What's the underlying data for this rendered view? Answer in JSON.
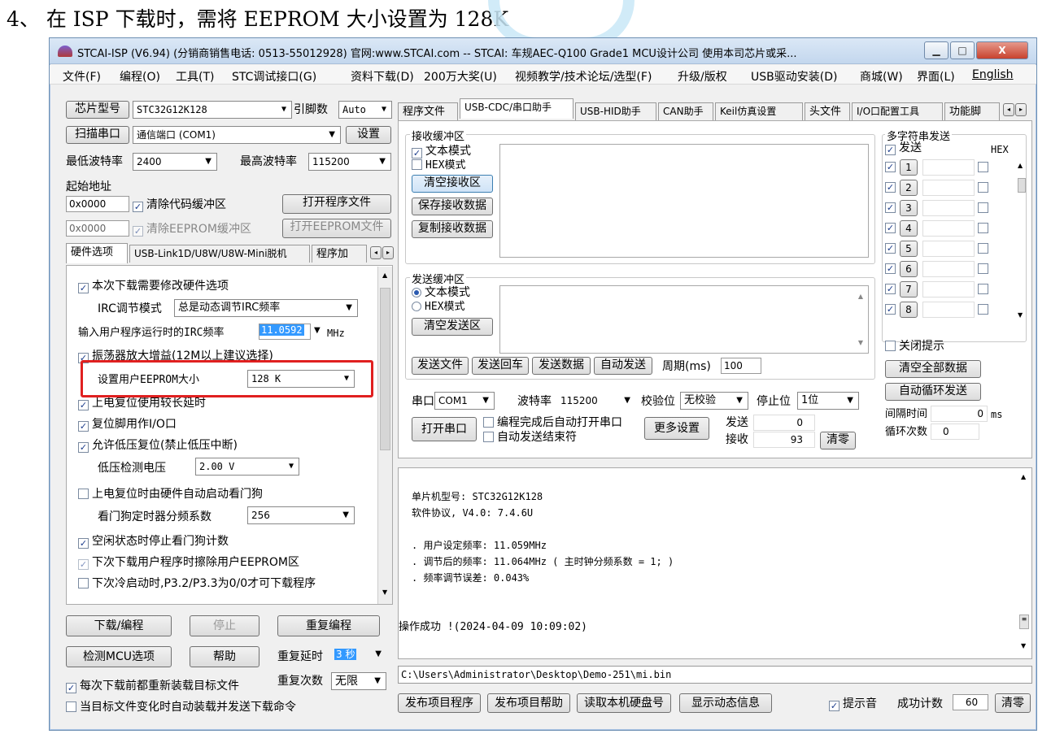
{
  "caption": "4、 在 ISP 下载时，需将 EEPROM 大小设置为 128K",
  "window": {
    "title": "STCAI-ISP (V6.94) (分销商销售电话: 0513-55012928) 官网:www.STCAI.com  -- STCAI: 车规AEC-Q100 Grade1 MCU设计公司 使用本司芯片或采...",
    "minimize": "▁",
    "maximize": "□",
    "close": "X"
  },
  "menu": [
    "文件(F)",
    "编程(O)",
    "工具(T)",
    "STC调试接口(G)",
    "资料下载(D)",
    "200万大奖(U)",
    "视频教学/技术论坛/选型(F)",
    "升级/版权",
    "USB驱动安装(D)",
    "商城(W)",
    "界面(L)",
    "English"
  ],
  "left": {
    "chip_btn": "芯片型号",
    "chip_value": "STC32G12K128",
    "pins_label": "引脚数",
    "pins_value": "Auto",
    "scan_btn": "扫描串口",
    "port_value": "通信端口 (COM1)",
    "settings_btn": "设置",
    "min_baud_label": "最低波特率",
    "min_baud": "2400",
    "max_baud_label": "最高波特率",
    "max_baud": "115200",
    "start_addr_label": "起始地址",
    "code_addr": "0x0000",
    "clear_code": "清除代码缓冲区",
    "open_prog": "打开程序文件",
    "eep_addr": "0x0000",
    "clear_eep": "清除EEPROM缓冲区",
    "open_eep": "打开EEPROM文件",
    "tabs": [
      "硬件选项",
      "USB-Link1D/U8W/U8W-Mini脱机",
      "程序加"
    ],
    "opt_hw": "本次下载需要修改硬件选项",
    "irc_mode_label": "IRC调节模式",
    "irc_mode": "总是动态调节IRC频率",
    "irc_freq_label": "输入用户程序运行时的IRC频率",
    "irc_freq": "11.0592",
    "irc_unit": "MHz",
    "opt_osc": "振荡器放大增益(12M以上建议选择)",
    "eeprom_label": "设置用户EEPROM大小",
    "eeprom_value": "128  K",
    "opt_delay": "上电复位使用较长延时",
    "opt_reset_io": "复位脚用作I/O口",
    "opt_lvr": "允许低压复位(禁止低压中断)",
    "lvd_label": "低压检测电压",
    "lvd_value": "2.00 V",
    "opt_wdt": "上电复位时由硬件自动启动看门狗",
    "wdt_div_label": "看门狗定时器分频系数",
    "wdt_div": "256",
    "opt_idle_wdt": "空闲状态时停止看门狗计数",
    "opt_erase_eep": "下次下载用户程序时擦除用户EEPROM区",
    "opt_cold": "下次冷启动时,P3.2/P3.3为0/0才可下载程序",
    "download_btn": "下载/编程",
    "stop_btn": "停止",
    "reprog_btn": "重复编程",
    "check_btn": "检测MCU选项",
    "help_btn": "帮助",
    "repeat_delay_label": "重复延时",
    "repeat_delay": "3 秒",
    "repeat_count_label": "重复次数",
    "repeat_count": "无限",
    "reload_each": "每次下载前都重新装载目标文件",
    "auto_reload": "当目标文件变化时自动装载并发送下载命令"
  },
  "right": {
    "tabs": [
      "程序文件",
      "USB-CDC/串口助手",
      "USB-HID助手",
      "CAN助手",
      "Keil仿真设置",
      "头文件",
      "I/O口配置工具",
      "功能脚"
    ],
    "rx_group": "接收缓冲区",
    "rx_text": "文本模式",
    "rx_hex": "HEX模式",
    "rx_clear": "清空接收区",
    "rx_save": "保存接收数据",
    "rx_copy": "复制接收数据",
    "tx_group": "发送缓冲区",
    "tx_text": "文本模式",
    "tx_hex": "HEX模式",
    "tx_clear": "清空发送区",
    "send_file": "发送文件",
    "send_return": "发送回车",
    "send_data": "发送数据",
    "auto_send": "自动发送",
    "period_label": "周期(ms)",
    "period": "100",
    "port_label": "串口",
    "port": "COM1",
    "baud_label": "波特率",
    "baud": "115200",
    "parity_label": "校验位",
    "parity": "无校验",
    "stop_label": "停止位",
    "stop": "1位",
    "open_port": "打开串口",
    "auto_open": "编程完成后自动打开串口",
    "auto_end": "自动发送结束符",
    "more_settings": "更多设置",
    "tx_label": "发送",
    "tx_count": "0",
    "rx_label": "接收",
    "rx_count": "93",
    "clear_counts": "清零",
    "multi_title": "多字符串发送",
    "multi_send": "发送",
    "multi_hex": "HEX",
    "multi_items": [
      "1",
      "2",
      "3",
      "4",
      "5",
      "6",
      "7",
      "8"
    ],
    "close_tips": "关闭提示",
    "clear_all": "清空全部数据",
    "auto_cycle": "自动循环发送",
    "interval_label": "间隔时间",
    "interval": "0",
    "interval_unit": "ms",
    "cycles_label": "循环次数",
    "cycles": "0"
  },
  "output": {
    "lines": [
      "单片机型号: STC32G12K128",
      "软件协议, V4.0: 7.4.6U",
      "",
      ". 用户设定频率: 11.059MHz",
      ". 调节后的频率: 11.064MHz ( 主时钟分频系数 = 1; )",
      ". 频率调节误差: 0.043%"
    ],
    "status": "操作成功 !(2024-04-09 10:09:02)",
    "path": "C:\\Users\\Administrator\\Desktop\\Demo-251\\mi.bin"
  },
  "bottom": {
    "publish_prog": "发布项目程序",
    "publish_help": "发布项目帮助",
    "read_disk": "读取本机硬盘号",
    "show_dyn": "显示动态信息",
    "beep": "提示音",
    "success_label": "成功计数",
    "success_count": "60",
    "clear": "清零"
  }
}
